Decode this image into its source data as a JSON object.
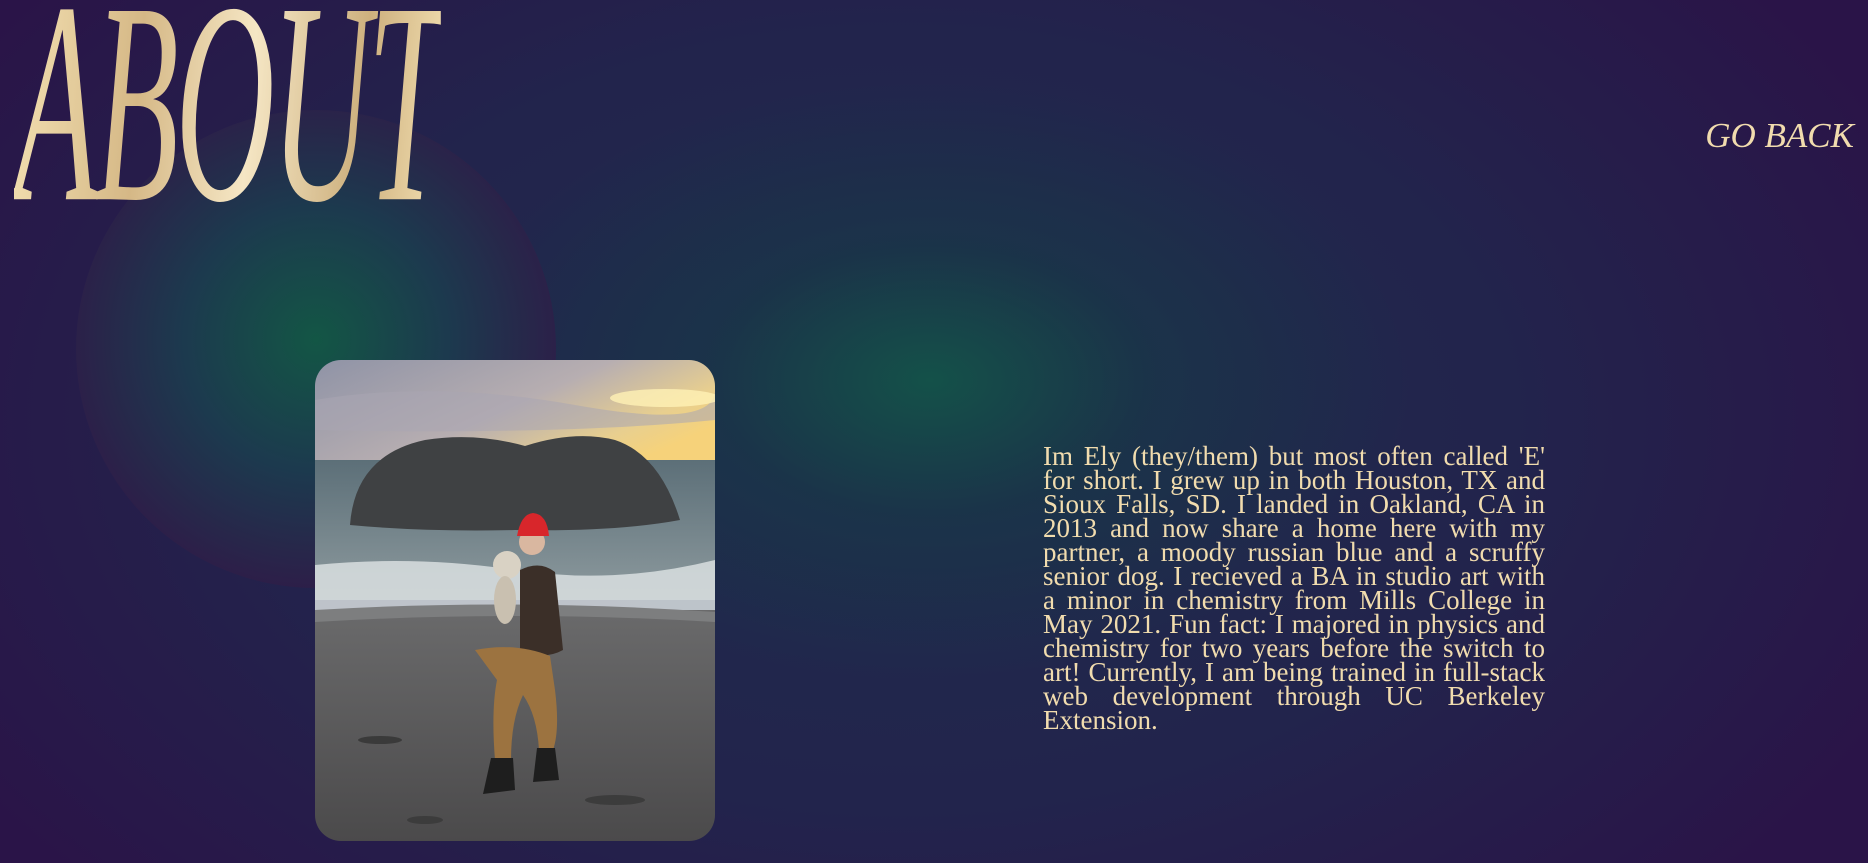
{
  "page": {
    "title": "ABOUT",
    "nav": {
      "go_back_label": "GO BACK"
    },
    "photo": {
      "alt": "Ely holding a small dog on a beach at sunset"
    },
    "bio": "Im Ely (they/them) but most often called 'E' for short. I grew up in both Houston, TX and Sioux Falls, SD. I landed in Oakland, CA in 2013 and now share a home here with my partner, a moody russian blue and a scruffy senior dog. I recieved a BA in studio art with a minor in chemistry from Mills College in May 2021. Fun fact: I majored in physics and chemistry for two years before the switch to art! Currently, I am being trained in full-stack web development through UC Berkeley Extension."
  },
  "colors": {
    "text_cream": "#f1dcae",
    "background_navy": "#22244c",
    "glow_green": "#135645",
    "edge_purple": "#2a1448"
  }
}
